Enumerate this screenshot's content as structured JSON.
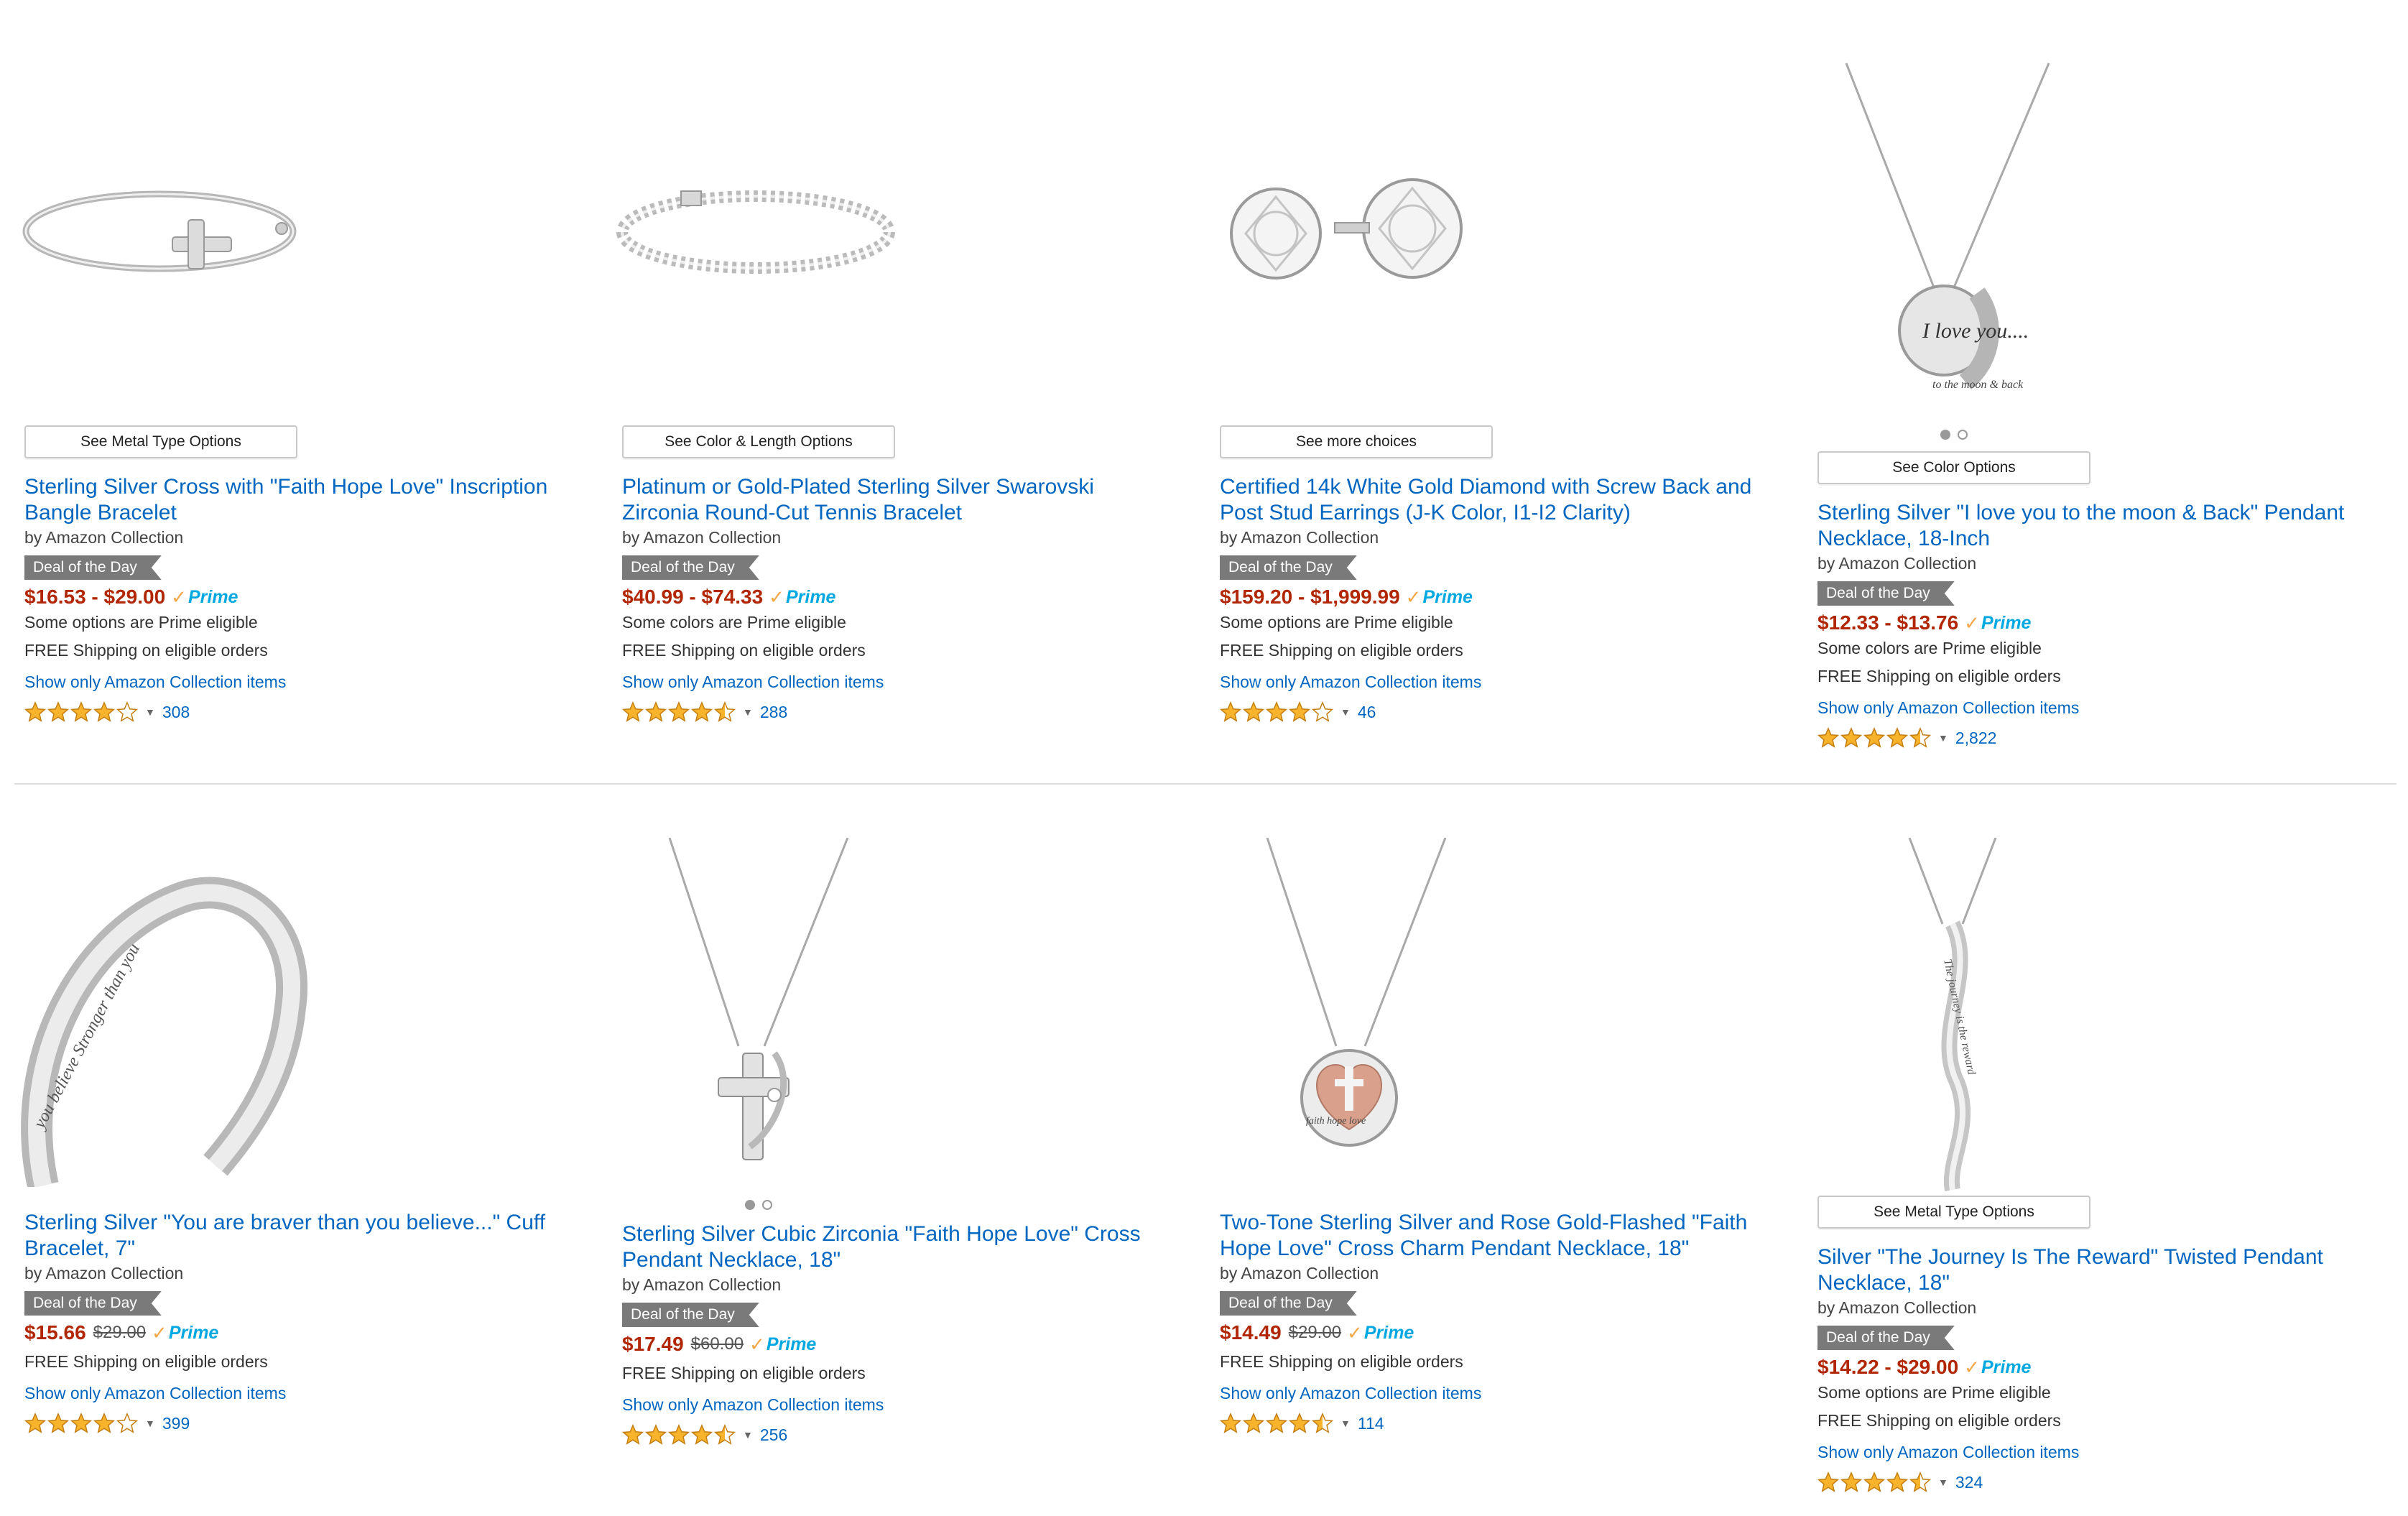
{
  "colors": {
    "link": "#0066c0",
    "price": "#b12704",
    "badge_bg": "#7a7a7a",
    "star_fill": "#f7b32b",
    "prime_blue": "#00a8e1",
    "prime_check": "#f3a847"
  },
  "products": [
    {
      "options_label": "See Metal Type Options",
      "title": "Sterling Silver Cross with \"Faith Hope Love\" Inscription Bangle Bracelet",
      "byline": "by Amazon Collection",
      "badge": "Deal of the Day",
      "price": "$16.53 - $29.00",
      "list_price": "",
      "prime_label": "Prime",
      "eligibility_note": "Some options are Prime eligible",
      "shipping": "FREE Shipping on eligible orders",
      "filter_link": "Show only Amazon Collection items",
      "rating": 4,
      "review_count": "308",
      "image_icon": "cross-bangle-bracelet-image"
    },
    {
      "options_label": "See Color & Length Options",
      "title": "Platinum or Gold-Plated Sterling Silver Swarovski Zirconia Round-Cut Tennis Bracelet",
      "byline": "by Amazon Collection",
      "badge": "Deal of the Day",
      "price": "$40.99 - $74.33",
      "list_price": "",
      "prime_label": "Prime",
      "eligibility_note": "Some colors are Prime eligible",
      "shipping": "FREE Shipping on eligible orders",
      "filter_link": "Show only Amazon Collection items",
      "rating": 4.5,
      "review_count": "288",
      "image_icon": "tennis-bracelet-image"
    },
    {
      "options_label": "See more choices",
      "title": "Certified 14k White Gold Diamond with Screw Back and Post Stud Earrings (J-K Color, I1-I2 Clarity)",
      "byline": "by Amazon Collection",
      "badge": "Deal of the Day",
      "price": "$159.20 - $1,999.99",
      "list_price": "",
      "prime_label": "Prime",
      "eligibility_note": "Some options are Prime eligible",
      "shipping": "FREE Shipping on eligible orders",
      "filter_link": "Show only Amazon Collection items",
      "rating": 4,
      "review_count": "46",
      "image_icon": "stud-earrings-image"
    },
    {
      "options_label": "See Color Options",
      "title": "Sterling Silver \"I love you to the moon & Back\" Pendant Necklace, 18-Inch",
      "byline": "by Amazon Collection",
      "badge": "Deal of the Day",
      "price": "$12.33 - $13.76",
      "list_price": "",
      "prime_label": "Prime",
      "eligibility_note": "Some colors are Prime eligible",
      "shipping": "FREE Shipping on eligible orders",
      "filter_link": "Show only Amazon Collection items",
      "rating": 4.5,
      "review_count": "2,822",
      "image_icon": "moon-pendant-necklace-image",
      "pendant_text": "I love you....",
      "rim_text": "to the moon & back"
    },
    {
      "options_label": "",
      "title": "Sterling Silver \"You are braver than you believe...\" Cuff Bracelet, 7\"",
      "byline": "by Amazon Collection",
      "badge": "Deal of the Day",
      "price": "$15.66",
      "list_price": "$29.00",
      "prime_label": "Prime",
      "eligibility_note": "",
      "shipping": "FREE Shipping on eligible orders",
      "filter_link": "Show only Amazon Collection items",
      "rating": 4,
      "review_count": "399",
      "image_icon": "cuff-bracelet-image",
      "engraving": "you believe Stronger than you"
    },
    {
      "options_label": "",
      "title": "Sterling Silver Cubic Zirconia \"Faith Hope Love\" Cross Pendant Necklace, 18\"",
      "byline": "by Amazon Collection",
      "badge": "Deal of the Day",
      "price": "$17.49",
      "list_price": "$60.00",
      "prime_label": "Prime",
      "eligibility_note": "",
      "shipping": "FREE Shipping on eligible orders",
      "filter_link": "Show only Amazon Collection items",
      "rating": 4.5,
      "review_count": "256",
      "image_icon": "cross-pendant-necklace-image"
    },
    {
      "options_label": "",
      "title": "Two-Tone Sterling Silver and Rose Gold-Flashed \"Faith Hope Love\" Cross Charm Pendant Necklace, 18\"",
      "byline": "by Amazon Collection",
      "badge": "Deal of the Day",
      "price": "$14.49",
      "list_price": "$29.00",
      "prime_label": "Prime",
      "eligibility_note": "",
      "shipping": "FREE Shipping on eligible orders",
      "filter_link": "Show only Amazon Collection items",
      "rating": 4.5,
      "review_count": "114",
      "image_icon": "heart-cross-charm-necklace-image",
      "charm_text": "faith hope love"
    },
    {
      "options_label": "See Metal Type Options",
      "title": "Silver \"The Journey Is The Reward\" Twisted Pendant Necklace, 18\"",
      "byline": "by Amazon Collection",
      "badge": "Deal of the Day",
      "price": "$14.22 - $29.00",
      "list_price": "",
      "prime_label": "Prime",
      "eligibility_note": "Some options are Prime eligible",
      "shipping": "FREE Shipping on eligible orders",
      "filter_link": "Show only Amazon Collection items",
      "rating": 4.5,
      "review_count": "324",
      "image_icon": "twisted-pendant-necklace-image",
      "engraving": "The journey is the reward"
    }
  ]
}
